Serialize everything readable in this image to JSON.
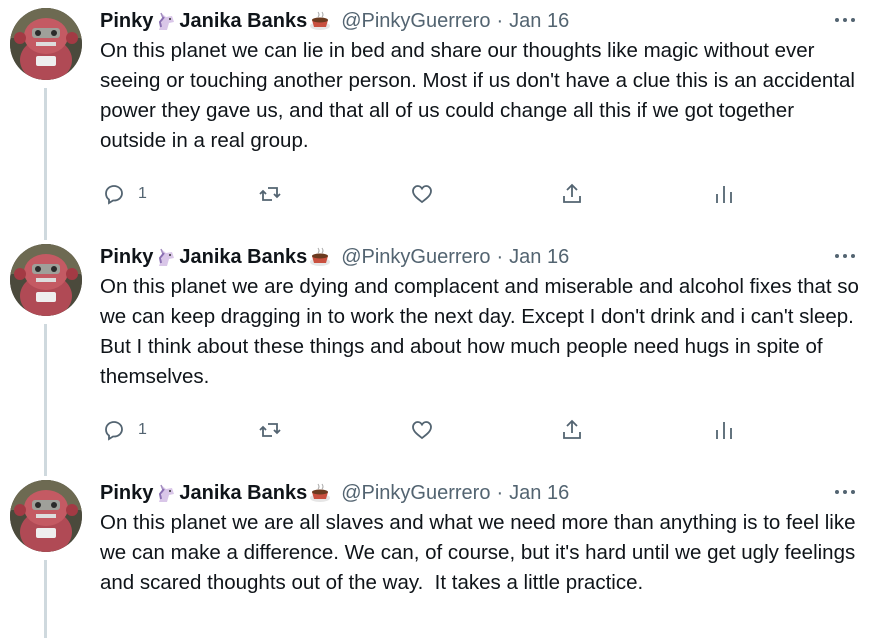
{
  "tweets": [
    {
      "name_first": "Pinky",
      "name_second": "Janika Banks",
      "handle": "@PinkyGuerrero",
      "separator": "·",
      "date": "Jan 16",
      "text": "On this planet we can lie in bed and share our thoughts like magic without ever seeing or touching another person. Most if us don't have a clue this is an accidental power they gave us, and that all of us could change all this if we got together outside in a real group.",
      "reply_count": "1"
    },
    {
      "name_first": "Pinky",
      "name_second": "Janika Banks",
      "handle": "@PinkyGuerrero",
      "separator": "·",
      "date": "Jan 16",
      "text": "On this planet we are dying and complacent and miserable and alcohol fixes that so we can keep dragging in to work the next day. Except I don't drink and i can't sleep. But I think about these things and about how much people need hugs in spite of themselves.",
      "reply_count": "1"
    },
    {
      "name_first": "Pinky",
      "name_second": "Janika Banks",
      "handle": "@PinkyGuerrero",
      "separator": "·",
      "date": "Jan 16",
      "text": "On this planet we are all slaves and what we need more than anything is to feel like we can make a difference. We can, of course, but it's hard until we get ugly feelings and scared thoughts out of the way.  It takes a little practice.",
      "reply_count": ""
    }
  ],
  "icons": {
    "name_emoji_1": "unicorn-emoji-icon",
    "name_emoji_2": "coffee-cup-emoji-icon",
    "more": "more-horizontal-icon",
    "reply": "reply-bubble-icon",
    "retweet": "retweet-icon",
    "like": "heart-icon",
    "share": "share-icon",
    "analytics": "analytics-bars-icon"
  },
  "colors": {
    "text": "#0f1419",
    "secondary": "#536471",
    "thread_line": "#cfd9de"
  }
}
